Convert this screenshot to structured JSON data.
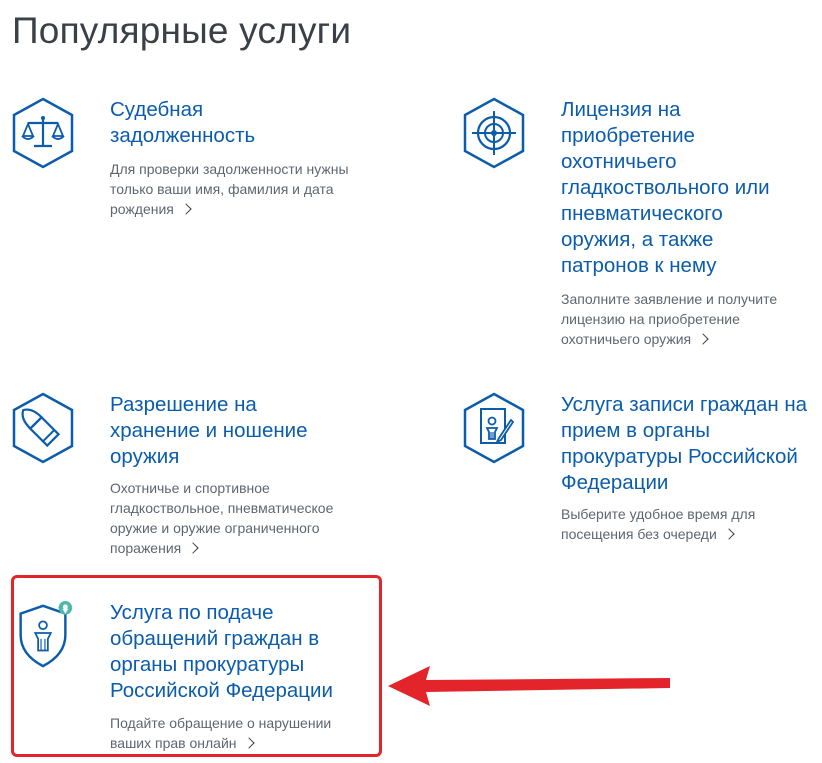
{
  "page": {
    "title": "Популярные услуги"
  },
  "services": [
    {
      "title": "Судебная задолженность",
      "description": "Для проверки задолженности нужны только ваши имя, фамилия и дата рождения",
      "icon": "scales-icon"
    },
    {
      "title": "Лицензия на приобретение охотничьего гладкоствольного или пневматического оружия, а также патронов к нему",
      "description": "Заполните заявление и получите лицензию на приобретение охотничьего оружия",
      "icon": "crosshair-target-icon"
    },
    {
      "title": "Разрешение на хранение и ношение оружия",
      "description": "Охотничье и спортивное гладкоствольное, пневматическое оружие и оружие ограниченного поражения",
      "icon": "bullet-icon"
    },
    {
      "title": "Услуга записи граждан на прием в органы прокуратуры Российской Федерации",
      "description": "Выберите удобное время для посещения без очереди",
      "icon": "prosecutor-document-pen-icon"
    },
    {
      "title": "Услуга по подаче обращений граждан в органы прокуратуры Российской Федерации",
      "description": "Подайте обращение о нарушении ваших прав онлайн",
      "icon": "prosecutor-shield-location-icon"
    }
  ],
  "colors": {
    "link": "#0b5cad",
    "icon_stroke": "#0b5cad",
    "text": "#3b4047",
    "muted": "#5f6670",
    "highlight": "#e3242b",
    "badge": "#4fb9a8"
  }
}
